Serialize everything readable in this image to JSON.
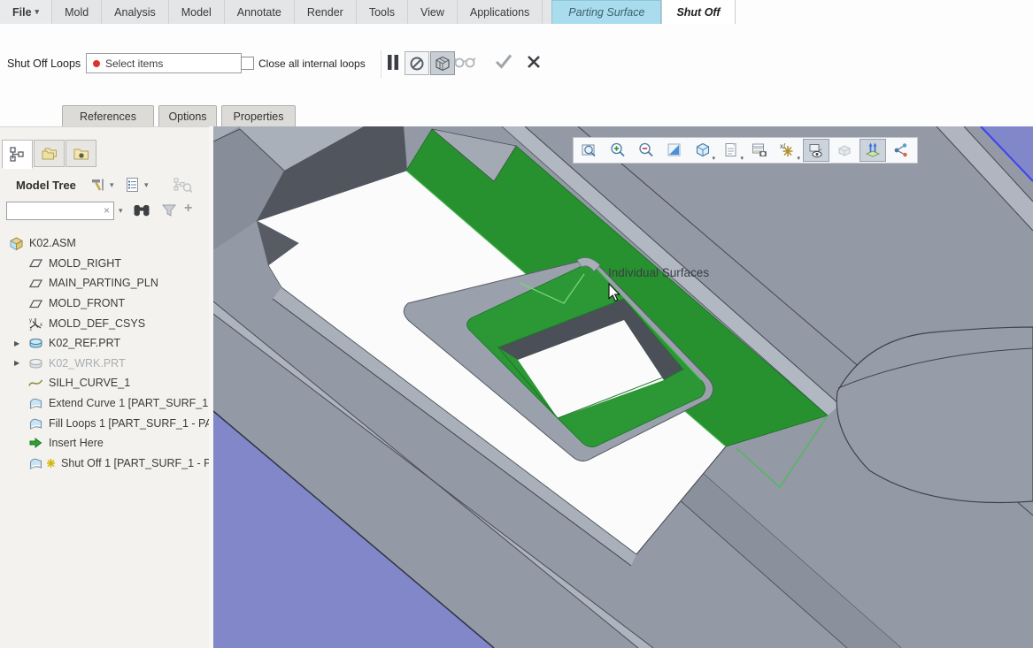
{
  "ribbon": {
    "file_label": "File",
    "tabs": [
      "Mold",
      "Analysis",
      "Model",
      "Annotate",
      "Render",
      "Tools",
      "View",
      "Applications"
    ],
    "contextual": [
      {
        "label": "Parting Surface",
        "active": false
      },
      {
        "label": "Shut Off",
        "active": true
      }
    ]
  },
  "dashboard": {
    "group_label": "Shut Off Loops",
    "collector_text": "Select items",
    "checkbox_label": "Close all internal loops",
    "checkbox_checked": false,
    "icons": [
      "pause",
      "no-preview",
      "wireframe-preview",
      "verify-glasses",
      "accept",
      "cancel"
    ]
  },
  "subtabs": [
    "References",
    "Options",
    "Properties"
  ],
  "model_tree": {
    "title": "Model Tree",
    "search_value": "",
    "header_icons": [
      "settings-tools",
      "list-options",
      "tree-columns"
    ],
    "search_icons": [
      "clear-x",
      "dropdown",
      "find-binoculars",
      "filter-funnel",
      "add-plus"
    ],
    "panel_tab_icons": [
      "model-tree-tab",
      "folder-browser-tab",
      "favorites-tab"
    ],
    "items": [
      {
        "label": "K02.ASM",
        "icon": "assembly",
        "level": 0
      },
      {
        "label": "MOLD_RIGHT",
        "icon": "datum-plane",
        "level": 1
      },
      {
        "label": "MAIN_PARTING_PLN",
        "icon": "datum-plane",
        "level": 1
      },
      {
        "label": "MOLD_FRONT",
        "icon": "datum-plane",
        "level": 1
      },
      {
        "label": "MOLD_DEF_CSYS",
        "icon": "csys",
        "level": 1
      },
      {
        "label": "K02_REF.PRT",
        "icon": "part",
        "level": 1,
        "expandable": true
      },
      {
        "label": "K02_WRK.PRT",
        "icon": "part-gray",
        "level": 1,
        "expandable": true,
        "dimmed": true
      },
      {
        "label": "SILH_CURVE_1",
        "icon": "curve",
        "level": 1
      },
      {
        "label": "Extend Curve 1 [PART_SURF_1",
        "icon": "quilt",
        "level": 1
      },
      {
        "label": "Fill Loops 1 [PART_SURF_1 - PA",
        "icon": "quilt",
        "level": 1
      },
      {
        "label": "Insert Here",
        "icon": "insert-arrow",
        "level": 1
      },
      {
        "label": "Shut Off 1 [PART_SURF_1 - PA",
        "icon": "quilt-star",
        "level": 1
      }
    ]
  },
  "viewport": {
    "tooltip": "Individual Surfaces",
    "toolbar": [
      {
        "name": "refit"
      },
      {
        "name": "zoom-in"
      },
      {
        "name": "zoom-out"
      },
      {
        "name": "repaint"
      },
      {
        "name": "display-style"
      },
      {
        "name": "saved-orientations"
      },
      {
        "name": "view-manager"
      },
      {
        "name": "datum-display-filters"
      },
      {
        "name": "annotation-display",
        "pressed": true
      },
      {
        "name": "spin-center"
      },
      {
        "name": "drag-handles",
        "pressed": true
      },
      {
        "name": "connections"
      }
    ]
  },
  "colors": {
    "shutoff_green": "#27912f",
    "buckle_green": "#2b9735",
    "datum_purple": "#8187c9",
    "highlight_blue_edge": "#3d43f0",
    "base_gray": "#9399a5",
    "parting_white": "#fbfbfc",
    "contextual_tab_cyan": "#a9dcec",
    "collector_dot_red": "#e03328"
  }
}
